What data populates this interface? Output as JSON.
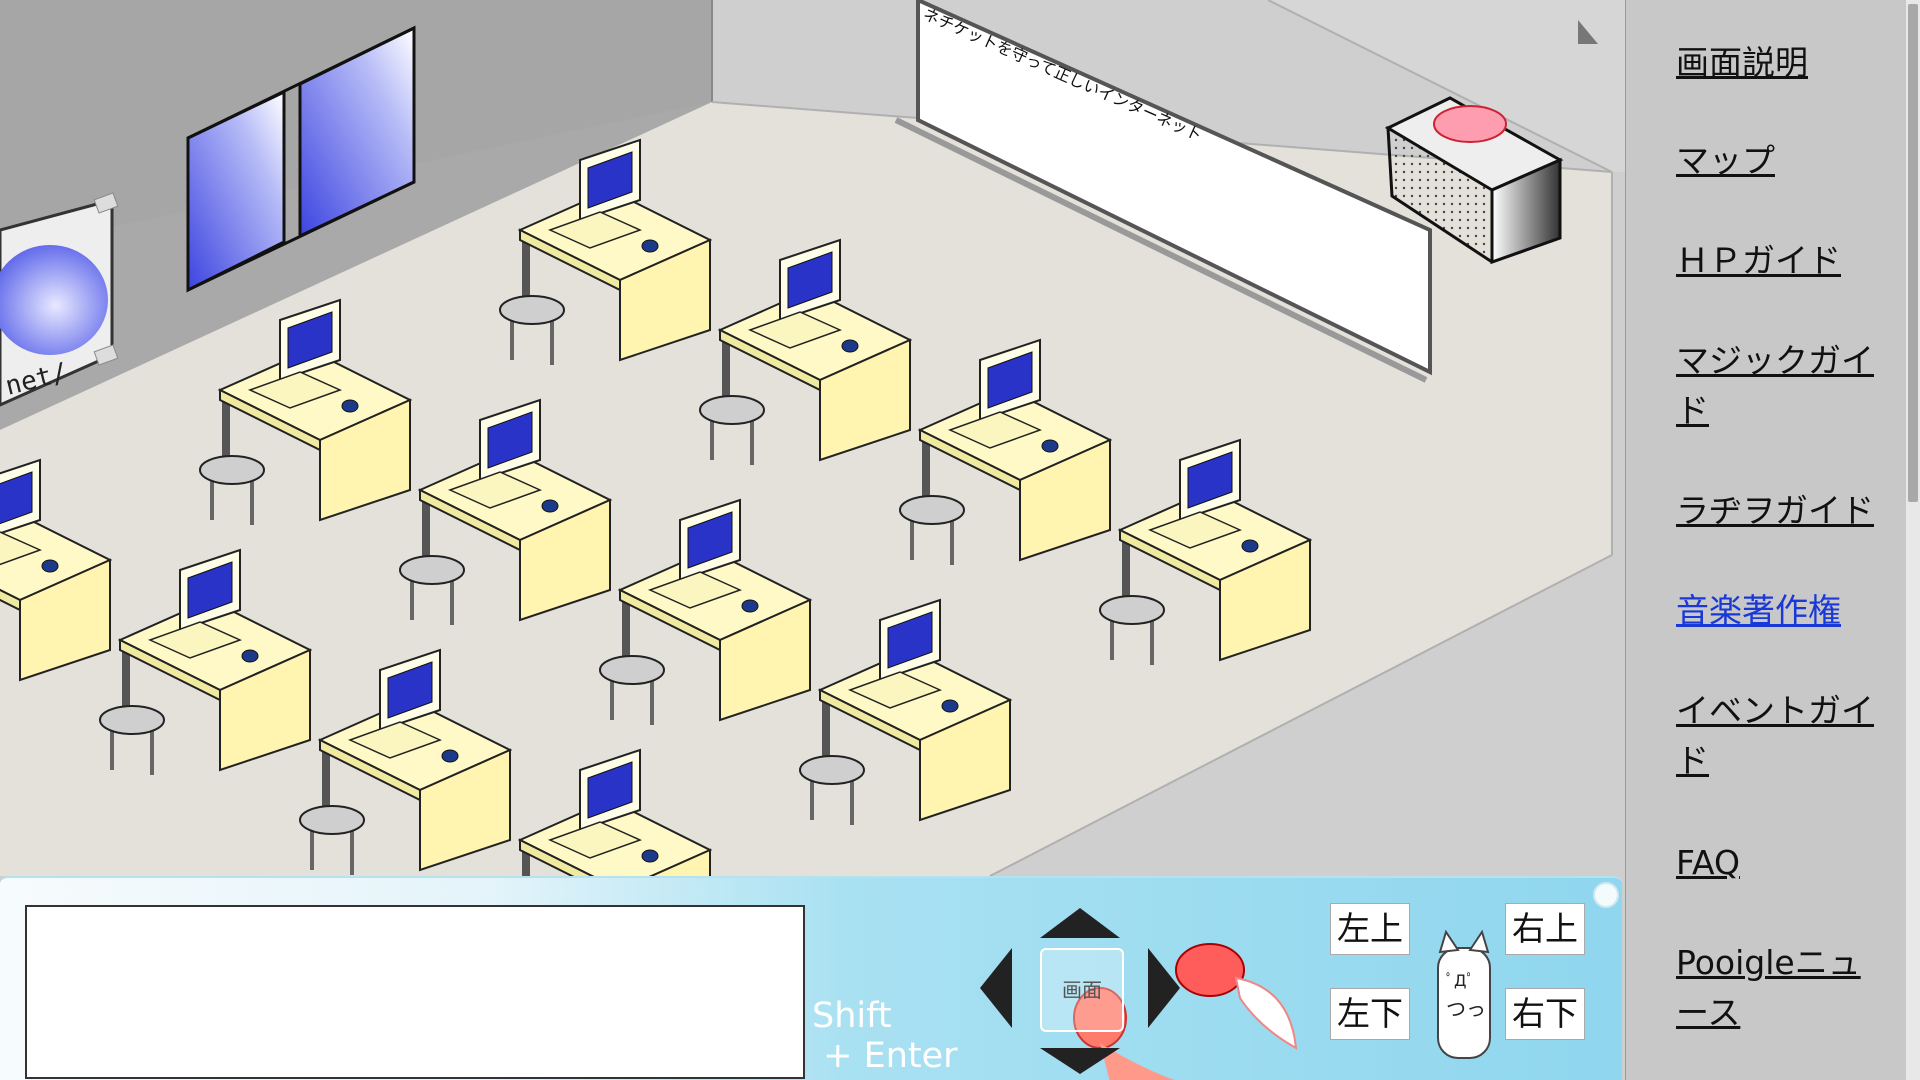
{
  "classroom": {
    "whiteboard_text": "ネチケットを守って正しいインターネット",
    "poster_text": "net/",
    "poster_face": "(ﾟДﾟ)"
  },
  "sidebar": {
    "items": [
      {
        "label": "画面説明"
      },
      {
        "label": "マップ"
      },
      {
        "label": "ＨＰガイド"
      },
      {
        "label": "マジックガイド"
      },
      {
        "label": "ラヂヲガイド"
      },
      {
        "label": "音楽著作権"
      },
      {
        "label": "イベントガイド"
      },
      {
        "label": "FAQ"
      },
      {
        "label": "Pooigleニュース"
      }
    ]
  },
  "controls": {
    "chat_placeholder": "",
    "send_hint_line1": "Shift",
    "send_hint_line2": " + Enter",
    "center_label": "画面",
    "up_left": "左上",
    "up_right": "右上",
    "down_left": "左下",
    "down_right": "右下"
  },
  "colors": {
    "wall": "#a9a9a9",
    "floor": "#e3e1da",
    "desk": "#fff9c7",
    "screen": "#2a33c8",
    "panel_accent": "#8fd6ee",
    "visited_link": "#1a38d8"
  }
}
